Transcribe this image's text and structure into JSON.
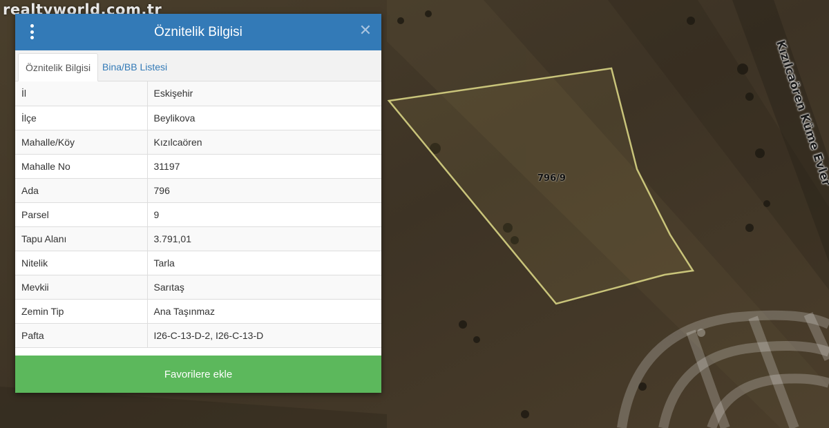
{
  "watermark": "realtyworld.com.tr",
  "map": {
    "road_label": "Kızılcaören Küme Evler",
    "parcel_label": "796/9",
    "parcel_outline_color": "#c9c47a",
    "icons": [
      "globe-logo-icon"
    ]
  },
  "panel": {
    "title": "Öznitelik Bilgisi",
    "header_color": "#337ab7",
    "tabs": [
      {
        "label": "Öznitelik Bilgisi",
        "active": true
      },
      {
        "label": "Bina/BB Listesi",
        "active": false
      }
    ],
    "rows": [
      {
        "key": "İl",
        "value": "Eskişehir"
      },
      {
        "key": "İlçe",
        "value": "Beylikova"
      },
      {
        "key": "Mahalle/Köy",
        "value": "Kızılcaören"
      },
      {
        "key": "Mahalle No",
        "value": "31197"
      },
      {
        "key": "Ada",
        "value": "796"
      },
      {
        "key": "Parsel",
        "value": "9"
      },
      {
        "key": "Tapu Alanı",
        "value": "3.791,01"
      },
      {
        "key": "Nitelik",
        "value": "Tarla"
      },
      {
        "key": "Mevkii",
        "value": "Sarıtaş"
      },
      {
        "key": "Zemin Tip",
        "value": "Ana Taşınmaz"
      },
      {
        "key": "Pafta",
        "value": "I26-C-13-D-2, I26-C-13-D"
      }
    ],
    "favorite_button": "Favorilere ekle",
    "favorite_color": "#5cb85c"
  }
}
